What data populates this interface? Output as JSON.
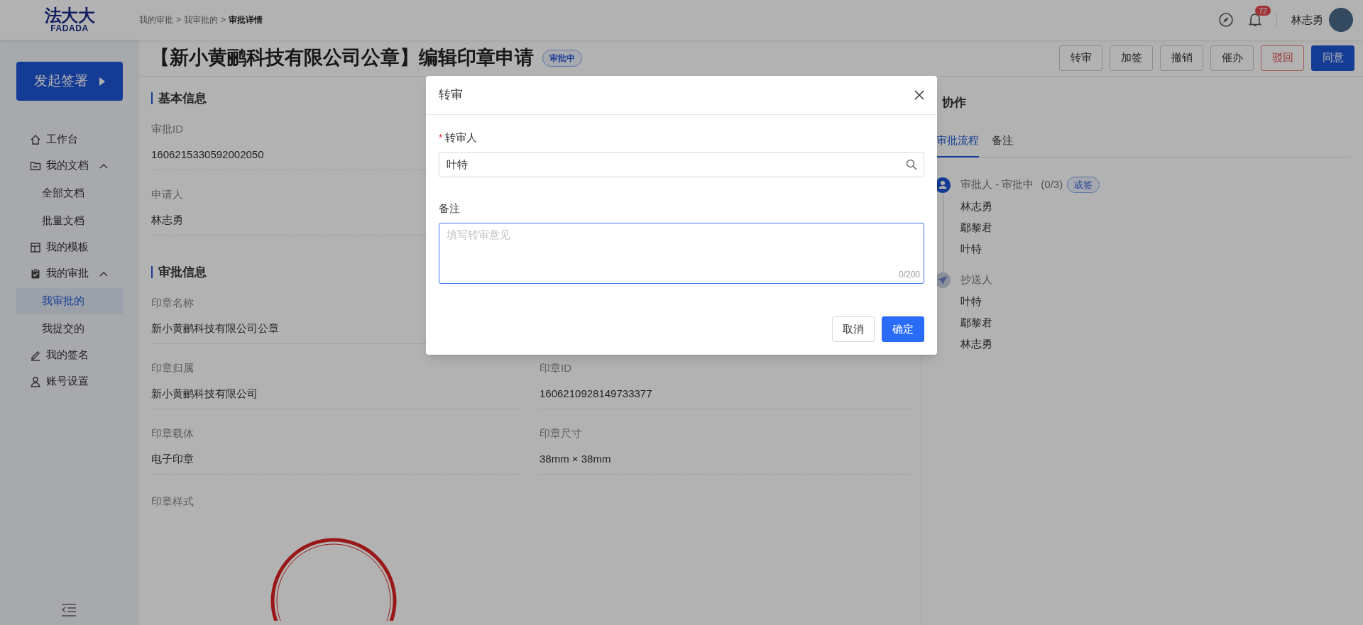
{
  "logo": {
    "mark": "法大大",
    "wordmark": "FADADA"
  },
  "breadcrumb": {
    "separator": ">",
    "items": [
      {
        "label": "我的审批",
        "current": false
      },
      {
        "label": "我审批的",
        "current": false
      },
      {
        "label": "审批详情",
        "current": true
      }
    ]
  },
  "header": {
    "notification_count": "72",
    "user_name": "林志勇"
  },
  "sidebar": {
    "start_button": "发起签署",
    "items": [
      {
        "label": "工作台"
      },
      {
        "label": "我的文档",
        "expanded": true,
        "children": [
          {
            "label": "全部文档",
            "selected": false
          },
          {
            "label": "批量文档",
            "selected": false
          }
        ]
      },
      {
        "label": "我的模板"
      },
      {
        "label": "我的审批",
        "expanded": true,
        "children": [
          {
            "label": "我审批的",
            "selected": true
          },
          {
            "label": "我提交的",
            "selected": false
          }
        ]
      },
      {
        "label": "我的签名"
      },
      {
        "label": "账号设置"
      }
    ]
  },
  "page": {
    "title": "【新小黄鹂科技有限公司公章】编辑印章申请",
    "status": "审批中",
    "actions": [
      {
        "label": "转审",
        "kind": "default"
      },
      {
        "label": "加签",
        "kind": "default"
      },
      {
        "label": "撤销",
        "kind": "default"
      },
      {
        "label": "催办",
        "kind": "default"
      },
      {
        "label": "驳回",
        "kind": "danger"
      },
      {
        "label": "同意",
        "kind": "primary"
      }
    ]
  },
  "sections": [
    {
      "title": "基本信息",
      "rows": [
        [
          {
            "label": "审批ID",
            "value": "1606215330592002050"
          }
        ],
        [
          {
            "label": "申请人",
            "value": "林志勇"
          }
        ]
      ]
    },
    {
      "title": "审批信息",
      "rows": [
        [
          {
            "label": "印章名称",
            "value": "新小黄鹂科技有限公司公章"
          }
        ],
        [
          {
            "label": "印章归属",
            "value": "新小黄鹂科技有限公司"
          },
          {
            "label": "印章ID",
            "value": "1606210928149733377"
          }
        ],
        [
          {
            "label": "印章载体",
            "value": "电子印章"
          },
          {
            "label": "印章尺寸",
            "value": "38mm × 38mm"
          }
        ]
      ],
      "seal_label": "印章样式"
    }
  ],
  "collaboration": {
    "title": "协作",
    "tabs": [
      {
        "label": "审批流程",
        "selected": true
      },
      {
        "label": "备注",
        "selected": false
      }
    ],
    "steps": [
      {
        "kind": "approver",
        "title": "审批人 - 审批中",
        "count": "(0/3)",
        "tag": "或签",
        "people": [
          "林志勇",
          "鄢黎君",
          "叶特"
        ]
      },
      {
        "kind": "cc",
        "title": "抄送人",
        "people": [
          "叶特",
          "鄢黎君",
          "林志勇"
        ]
      }
    ]
  },
  "dialog": {
    "title": "转审",
    "fields": [
      {
        "kind": "search",
        "label": "转审人",
        "required_mark": "*",
        "value": "叶特"
      },
      {
        "kind": "textarea",
        "label": "备注",
        "placeholder": "填写转审意见",
        "counter": "0/200"
      }
    ],
    "buttons": [
      {
        "label": "取消",
        "kind": "default"
      },
      {
        "label": "确定",
        "kind": "primary"
      }
    ]
  }
}
